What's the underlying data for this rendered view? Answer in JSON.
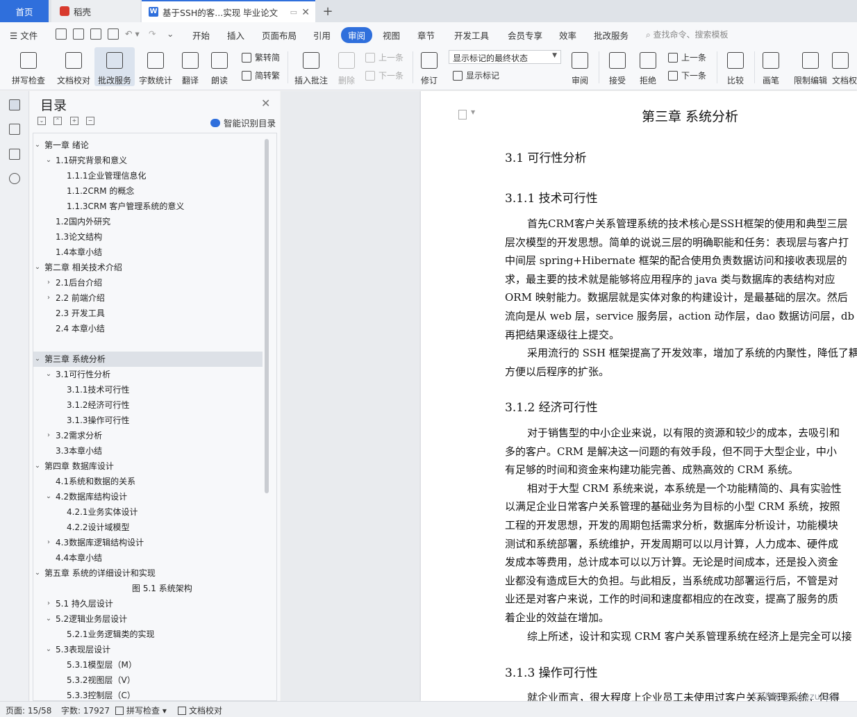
{
  "tabs": {
    "home": "首页",
    "daoke": "稻壳",
    "doc": "基于SSH的客...实现 毕业论文"
  },
  "menu": {
    "file": "文件",
    "items": [
      "开始",
      "插入",
      "页面布局",
      "引用",
      "审阅",
      "视图",
      "章节",
      "开发工具",
      "会员专享",
      "效率",
      "批改服务"
    ],
    "active": "审阅",
    "search_placeholder": "查找命令、搜索模板"
  },
  "ribbon": {
    "spellcheck": "拼写检查",
    "doc_proof": "文档校对",
    "correction_service": "批改服务",
    "word_count": "字数统计",
    "translate": "翻译",
    "read_aloud": "朗读",
    "trad_simp": "繁转简",
    "simp_trad": "简转繁",
    "insert_comment": "插入批注",
    "delete": "删除",
    "prev": "上一条",
    "next": "下一条",
    "track_changes": "修订",
    "markup_select": "显示标记的最终状态",
    "show_markup": "显示标记",
    "review": "审阅",
    "accept": "接受",
    "reject": "拒绝",
    "prev2": "上一条",
    "next2": "下一条",
    "compare": "比较",
    "pen": "画笔",
    "restrict_edit": "限制编辑",
    "doc_perm": "文档权"
  },
  "toc": {
    "title": "目录",
    "smart": "智能识别目录",
    "items": [
      {
        "label": "第一章  绪论",
        "level": 0,
        "arrow": "v"
      },
      {
        "label": "1.1研究背景和意义",
        "level": 1,
        "arrow": "v"
      },
      {
        "label": "1.1.1企业管理信息化",
        "level": 2,
        "arrow": ""
      },
      {
        "label": "1.1.2CRM 的概念",
        "level": 2,
        "arrow": ""
      },
      {
        "label": "1.1.3CRM 客户管理系统的意义",
        "level": 2,
        "arrow": ""
      },
      {
        "label": "1.2国内外研究",
        "level": 1,
        "arrow": ""
      },
      {
        "label": "1.3论文结构",
        "level": 1,
        "arrow": ""
      },
      {
        "label": "1.4本章小结",
        "level": 1,
        "arrow": ""
      },
      {
        "label": "第二章  相关技术介绍",
        "level": 0,
        "arrow": "v"
      },
      {
        "label": "2.1后台介绍",
        "level": 1,
        "arrow": ">"
      },
      {
        "label": "2.2 前端介绍",
        "level": 1,
        "arrow": ">"
      },
      {
        "label": "2.3 开发工具",
        "level": 1,
        "arrow": ""
      },
      {
        "label": "2.4 本章小结",
        "level": 1,
        "arrow": ""
      },
      {
        "label": "",
        "level": 0,
        "arrow": ""
      },
      {
        "label": "第三章  系统分析",
        "level": 0,
        "arrow": "v",
        "selected": true
      },
      {
        "label": "3.1可行性分析",
        "level": 1,
        "arrow": "v"
      },
      {
        "label": "3.1.1技术可行性",
        "level": 2,
        "arrow": ""
      },
      {
        "label": "3.1.2经济可行性",
        "level": 2,
        "arrow": ""
      },
      {
        "label": "3.1.3操作可行性",
        "level": 2,
        "arrow": ""
      },
      {
        "label": "3.2需求分析",
        "level": 1,
        "arrow": ">"
      },
      {
        "label": "3.3本章小结",
        "level": 1,
        "arrow": ""
      },
      {
        "label": "第四章  数据库设计",
        "level": 0,
        "arrow": "v"
      },
      {
        "label": "4.1系统和数据的关系",
        "level": 1,
        "arrow": ""
      },
      {
        "label": "4.2数据库结构设计",
        "level": 1,
        "arrow": "v"
      },
      {
        "label": "4.2.1业务实体设计",
        "level": 2,
        "arrow": ""
      },
      {
        "label": "4.2.2设计域模型",
        "level": 2,
        "arrow": ""
      },
      {
        "label": "4.3数据库逻辑结构设计",
        "level": 1,
        "arrow": ">"
      },
      {
        "label": "4.4本章小结",
        "level": 1,
        "arrow": ""
      },
      {
        "label": "第五章  系统的详细设计和实现",
        "level": 0,
        "arrow": "v"
      },
      {
        "label": "图 5.1 系统架构",
        "level": 3,
        "arrow": ""
      },
      {
        "label": "5.1 持久层设计",
        "level": 1,
        "arrow": ">"
      },
      {
        "label": "5.2逻辑业务层设计",
        "level": 1,
        "arrow": "v"
      },
      {
        "label": "5.2.1业务逻辑类的实现",
        "level": 2,
        "arrow": ""
      },
      {
        "label": "5.3表现层设计",
        "level": 1,
        "arrow": "v"
      },
      {
        "label": "5.3.1模型层（M）",
        "level": 2,
        "arrow": ""
      },
      {
        "label": "5.3.2视图层（V）",
        "level": 2,
        "arrow": ""
      },
      {
        "label": "5.3.3控制层（C）",
        "level": 2,
        "arrow": ""
      }
    ]
  },
  "doc": {
    "chapter_title": "第三章    系统分析",
    "h31": "3.1  可行性分析",
    "h311": "3.1.1  技术可行性",
    "p1": [
      "首先CRM客户关系管理系统的技术核心是SSH框架的使用和典型三层",
      "层次模型的开发思想。简单的说说三层的明确职能和任务：表现层与客户打",
      "中间层 spring+Hibernate 框架的配合使用负责数据访问和接收表现层的",
      "求，最主要的技术就是能够将应用程序的 java 类与数据库的表结构对应",
      "ORM 映射能力。数据层就是实体对象的构建设计，是最基础的层次。然后",
      "流向是从 web 层，service 服务层，action 动作层，dao 数据访问层，db 数",
      "再把结果逐级往上提交。"
    ],
    "p2": [
      "采用流行的 SSH 框架提高了开发效率，增加了系统的内聚性，降低了耦",
      "方便以后程序的扩张。"
    ],
    "h312": "3.1.2  经济可行性",
    "p3": [
      "对于销售型的中小企业来说，以有限的资源和较少的成本，去吸引和",
      "多的客户。CRM 是解决这一问题的有效手段，但不同于大型企业，中小",
      "有足够的时间和资金来构建功能完善、成熟高效的  CRM 系统。"
    ],
    "p4": [
      "相对于大型  CRM 系统来说，本系统是一个功能精简的、具有实验性",
      "以满足企业日常客户关系管理的基础业务为目标的小型  CRM 系统，按照",
      "工程的开发思想，开发的周期包括需求分析，数据库分析设计，功能模块",
      "测试和系统部署，系统维护，开发周期可以以月计算，人力成本、硬件成",
      "发成本等费用，总计成本可以以万计算。无论是时间成本，还是投入资金",
      "业都没有造成巨大的负担。与此相反，当系统成功部署运行后，不管是对",
      "业还是对客户来说，工作的时间和速度都相应的在改变，提高了服务的质",
      "着企业的效益在增加。"
    ],
    "p5": [
      "综上所述，设计和实现 CRM 客户关系管理系统在经济上是完全可以接"
    ],
    "h313": "3.1.3  操作可行性",
    "p6": [
      "就企业而言，很大程度上企业员工未使用过客户关系管理系统，但得"
    ]
  },
  "status": {
    "page": "页面: 15/58",
    "words": "字数: 17927",
    "spell": "拼写检查",
    "proof": "文档校对",
    "watermark": "CSDN @biyezuopin"
  }
}
